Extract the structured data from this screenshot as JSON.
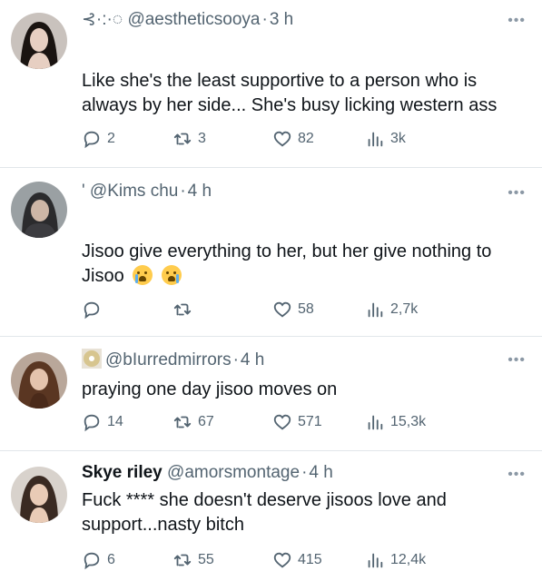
{
  "tweets": [
    {
      "prefix": "⊰·:·◌",
      "name": "",
      "handle": "@aestheticsooya",
      "time": "3 h",
      "text": "Like she's the least supportive to a person who is always by her side... She's busy licking western ass",
      "replies": "2",
      "retweets": "3",
      "likes": "82",
      "views": "3k"
    },
    {
      "prefix": "'",
      "name": "",
      "handle": "@Kims chu",
      "time": "4 h",
      "text": "Jisoo give everything to her, but her give nothing to Jisoo",
      "replies": "",
      "retweets": "",
      "likes": "58",
      "views": "2,7k"
    },
    {
      "prefix": "",
      "name": "",
      "handle": "@bIurredmirrors",
      "time": "4 h",
      "text": "praying one day jisoo moves on",
      "replies": "14",
      "retweets": "67",
      "likes": "571",
      "views": "15,3k"
    },
    {
      "prefix": "",
      "name": "Skye riley",
      "handle": "@amorsmontage",
      "time": "4 h",
      "text": "Fuck **** she doesn't deserve jisoos love and support...nasty bitch",
      "replies": "6",
      "retweets": "55",
      "likes": "415",
      "views": "12,4k"
    }
  ],
  "more_label": "•••",
  "separator": "·",
  "colors": {
    "text": "#0f1419",
    "muted": "#536471",
    "divider": "#e1e6ea"
  }
}
